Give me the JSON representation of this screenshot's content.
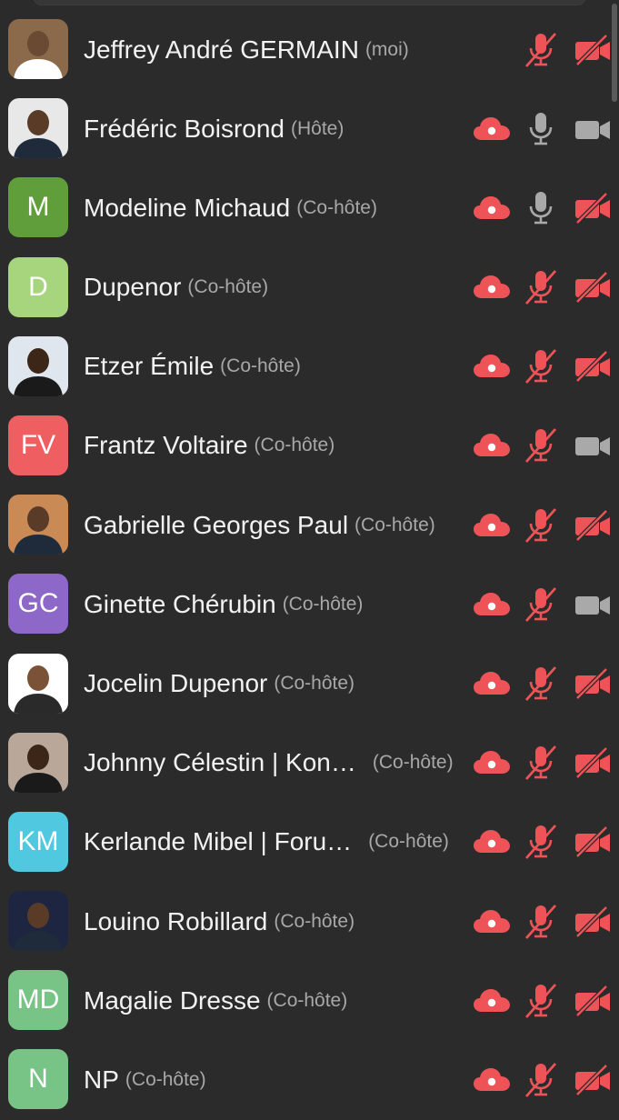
{
  "colors": {
    "background": "#2b2b2b",
    "red": "#ee5358",
    "gray_icon": "#a9a9a9",
    "role_text": "#a8a8a8"
  },
  "participants": [
    {
      "name": "Jeffrey André GERMAIN",
      "role": "(moi)",
      "avatar_type": "photo",
      "initials": "",
      "avatar_color": "#8a6a4a",
      "cloud": false,
      "mic_muted": true,
      "video_off": true
    },
    {
      "name": "Frédéric Boisrond",
      "role": "(Hôte)",
      "avatar_type": "photo",
      "initials": "",
      "avatar_color": "#e8e8e8",
      "cloud": true,
      "mic_muted": false,
      "video_off": false
    },
    {
      "name": "Modeline Michaud",
      "role": "(Co-hôte)",
      "avatar_type": "initials",
      "initials": "M",
      "avatar_color": "#5f9e3a",
      "cloud": true,
      "mic_muted": false,
      "video_off": true
    },
    {
      "name": "Dupenor",
      "role": "(Co-hôte)",
      "avatar_type": "initials",
      "initials": "D",
      "avatar_color": "#a6d57d",
      "cloud": true,
      "mic_muted": true,
      "video_off": true
    },
    {
      "name": "Etzer Émile",
      "role": "(Co-hôte)",
      "avatar_type": "photo",
      "initials": "",
      "avatar_color": "#dfe6ee",
      "cloud": true,
      "mic_muted": true,
      "video_off": true
    },
    {
      "name": "Frantz Voltaire",
      "role": "(Co-hôte)",
      "avatar_type": "initials",
      "initials": "FV",
      "avatar_color": "#ef5f62",
      "cloud": true,
      "mic_muted": true,
      "video_off": false
    },
    {
      "name": "Gabrielle Georges Paul",
      "role": "(Co-hôte)",
      "avatar_type": "photo",
      "initials": "",
      "avatar_color": "#c98a55",
      "cloud": true,
      "mic_muted": true,
      "video_off": true
    },
    {
      "name": "Ginette Chérubin",
      "role": "(Co-hôte)",
      "avatar_type": "initials",
      "initials": "GC",
      "avatar_color": "#8d68c8",
      "cloud": true,
      "mic_muted": true,
      "video_off": false
    },
    {
      "name": "Jocelin Dupenor",
      "role": "(Co-hôte)",
      "avatar_type": "photo",
      "initials": "",
      "avatar_color": "#ffffff",
      "cloud": true,
      "mic_muted": true,
      "video_off": true
    },
    {
      "name": "Johnny Célestin | Kon…",
      "role": "(Co-hôte)",
      "avatar_type": "photo",
      "initials": "",
      "avatar_color": "#b9a89a",
      "cloud": true,
      "mic_muted": true,
      "video_off": true,
      "truncated": true
    },
    {
      "name": "Kerlande Mibel | Foru…",
      "role": "(Co-hôte)",
      "avatar_type": "initials",
      "initials": "KM",
      "avatar_color": "#4fc8e0",
      "cloud": true,
      "mic_muted": true,
      "video_off": true,
      "truncated": true
    },
    {
      "name": "Louino Robillard",
      "role": "(Co-hôte)",
      "avatar_type": "photo",
      "initials": "",
      "avatar_color": "#1d2540",
      "cloud": true,
      "mic_muted": true,
      "video_off": true
    },
    {
      "name": "Magalie Dresse",
      "role": "(Co-hôte)",
      "avatar_type": "initials",
      "initials": "MD",
      "avatar_color": "#78c487",
      "cloud": true,
      "mic_muted": true,
      "video_off": true
    },
    {
      "name": "NP",
      "role": "(Co-hôte)",
      "avatar_type": "initials",
      "initials": "N",
      "avatar_color": "#78c487",
      "cloud": true,
      "mic_muted": true,
      "video_off": true
    }
  ]
}
